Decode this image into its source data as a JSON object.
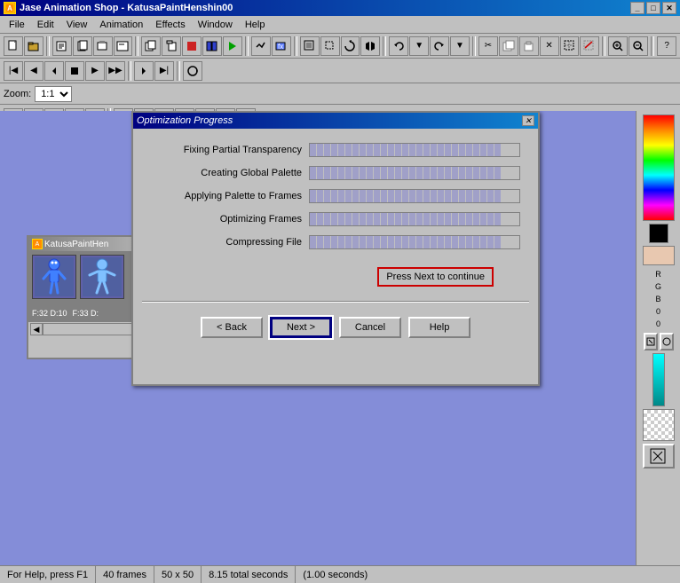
{
  "app": {
    "title": "Jase Animation Shop - KatusaPaintHenshin00",
    "icon": "★"
  },
  "titlebar": {
    "minimize": "_",
    "maximize": "□",
    "close": "✕"
  },
  "menu": {
    "items": [
      "File",
      "Edit",
      "View",
      "Animation",
      "Effects",
      "Window",
      "Help"
    ]
  },
  "zoom": {
    "label": "Zoom:",
    "value": "1:1"
  },
  "dialog": {
    "title": "Optimization Progress",
    "close": "✕",
    "steps": [
      {
        "label": "Fixing Partial Transparency",
        "fill": 100
      },
      {
        "label": "Creating Global Palette",
        "fill": 100
      },
      {
        "label": "Applying Palette to Frames",
        "fill": 100
      },
      {
        "label": "Optimizing Frames",
        "fill": 100
      },
      {
        "label": "Compressing File",
        "fill": 100
      }
    ],
    "press_next_msg": "Press Next to continue",
    "buttons": {
      "back": "< Back",
      "next": "Next >",
      "cancel": "Cancel",
      "help": "Help"
    }
  },
  "anim_window": {
    "title": "KatusaPaintHen",
    "frames": [
      {
        "label": "F:32 D:10"
      },
      {
        "label": "F:33 D:"
      }
    ]
  },
  "right_panel": {
    "rgb_label": "R\nG\nB\n0\n0"
  },
  "status": {
    "help": "For Help, press F1",
    "frames": "40 frames",
    "size": "50 x 50",
    "time": "8.15 total seconds",
    "fps": "(1.00 seconds)"
  }
}
